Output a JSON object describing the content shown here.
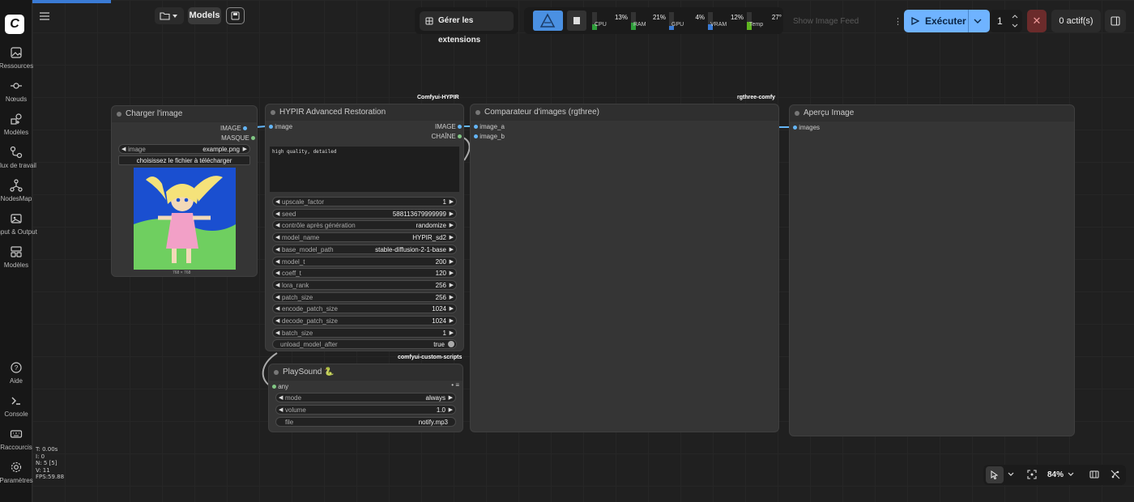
{
  "sidebar": {
    "items": [
      {
        "label": "Ressources",
        "icon": "image-stack-icon"
      },
      {
        "label": "Nœuds",
        "icon": "node-icon"
      },
      {
        "label": "Modèles",
        "icon": "model-icon"
      },
      {
        "label": "Flux de travail",
        "icon": "workflow-icon"
      },
      {
        "label": "NodesMap",
        "icon": "nodesmap-icon"
      },
      {
        "label": "Input & Output",
        "icon": "gallery-icon"
      },
      {
        "label": "Modèles",
        "icon": "template-icon"
      }
    ],
    "bottom": [
      {
        "label": "Aide",
        "icon": "help-icon"
      },
      {
        "label": "Console",
        "icon": "console-icon"
      },
      {
        "label": "Raccourcis",
        "icon": "keyboard-icon"
      },
      {
        "label": "Paramètres",
        "icon": "settings-icon"
      }
    ]
  },
  "topbar": {
    "models_label": "Models",
    "extensions_label": "Gérer les extensions",
    "monitors": [
      {
        "name": "CPU",
        "value": "13%",
        "fill": 0.13,
        "color": "#2e9e3a"
      },
      {
        "name": "RAM",
        "value": "21%",
        "fill": 0.21,
        "color": "#2e9e3a"
      },
      {
        "name": "GPU",
        "value": "4%",
        "fill": 0.04,
        "color": "#3a7bd5"
      },
      {
        "name": "VRAM",
        "value": "12%",
        "fill": 0.12,
        "color": "#3a7bd5"
      },
      {
        "name": "Temp",
        "value": "27°",
        "fill": 0.27,
        "color": "#5fb520"
      }
    ],
    "image_feed_label": "Show Image Feed",
    "run_label": "Exécuter",
    "run_count": "1",
    "active_label": "0 actif(s)"
  },
  "nodes": {
    "load_image": {
      "title": "Charger l'image",
      "out_image": "IMAGE",
      "out_mask": "MASQUE",
      "image_key": "image",
      "image_value": "example.png",
      "upload_label": "choisissez le fichier à télécharger",
      "dims": "768 × 768"
    },
    "hypir": {
      "title": "HYPIR Advanced Restoration",
      "tag": "Comfyui-HYPIR",
      "in_image": "image",
      "out_image": "IMAGE",
      "out_string": "CHAÎNE",
      "prompt": "high quality, detailed",
      "widgets": [
        {
          "k": "upscale_factor",
          "v": "1"
        },
        {
          "k": "seed",
          "v": "588113679999999"
        },
        {
          "k": "contrôle après génération",
          "v": "randomize"
        },
        {
          "k": "model_name",
          "v": "HYPIR_sd2"
        },
        {
          "k": "base_model_path",
          "v": "stable-diffusion-2-1-base"
        },
        {
          "k": "model_t",
          "v": "200"
        },
        {
          "k": "coeff_t",
          "v": "120"
        },
        {
          "k": "lora_rank",
          "v": "256"
        },
        {
          "k": "patch_size",
          "v": "256"
        },
        {
          "k": "encode_patch_size",
          "v": "1024"
        },
        {
          "k": "decode_patch_size",
          "v": "1024"
        },
        {
          "k": "batch_size",
          "v": "1"
        }
      ],
      "toggle_key": "unload_model_after",
      "toggle_value": "true"
    },
    "playsound": {
      "title": "PlaySound 🐍",
      "tag": "comfyui-custom-scripts",
      "in_any": "any",
      "widgets": [
        {
          "k": "mode",
          "v": "always"
        },
        {
          "k": "volume",
          "v": "1.0"
        }
      ],
      "file_key": "file",
      "file_value": "notify.mp3"
    },
    "comparer": {
      "title": "Comparateur d'images (rgthree)",
      "tag": "rgthree-comfy",
      "in_a": "image_a",
      "in_b": "image_b"
    },
    "preview": {
      "title": "Aperçu Image",
      "in_images": "images"
    }
  },
  "status": {
    "t": "T: 0.00s",
    "i": "I: 0",
    "n": "N: 5 [5]",
    "v": "V: 11",
    "fps": "FPS:59.88"
  },
  "zoom": "84%"
}
